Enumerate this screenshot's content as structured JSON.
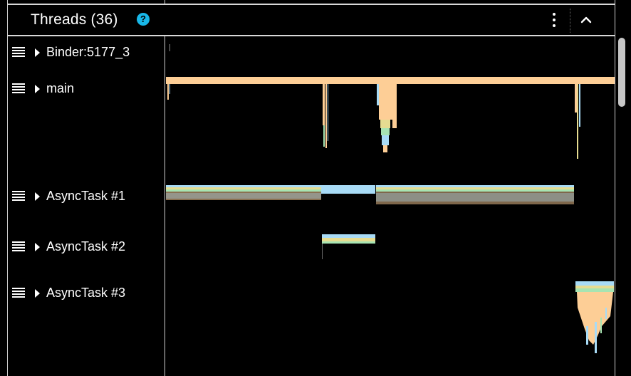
{
  "header": {
    "title": "Threads (36)",
    "help_icon": "help-icon",
    "more_icon": "vertical-ellipsis-icon",
    "collapse_icon": "chevron-up-icon"
  },
  "threads": [
    {
      "label": "Binder:5177_3"
    },
    {
      "label": "main"
    },
    {
      "label": "AsyncTask #1"
    },
    {
      "label": "AsyncTask #2"
    },
    {
      "label": "AsyncTask #3"
    }
  ],
  "colors": {
    "accent": "#18b7e8",
    "flame_orange": "#fdce96",
    "flame_blue": "#a8dbf6",
    "flame_green": "#a7e4b2",
    "flame_yellow": "#e6dc91",
    "divider": "#d8d8d8"
  }
}
